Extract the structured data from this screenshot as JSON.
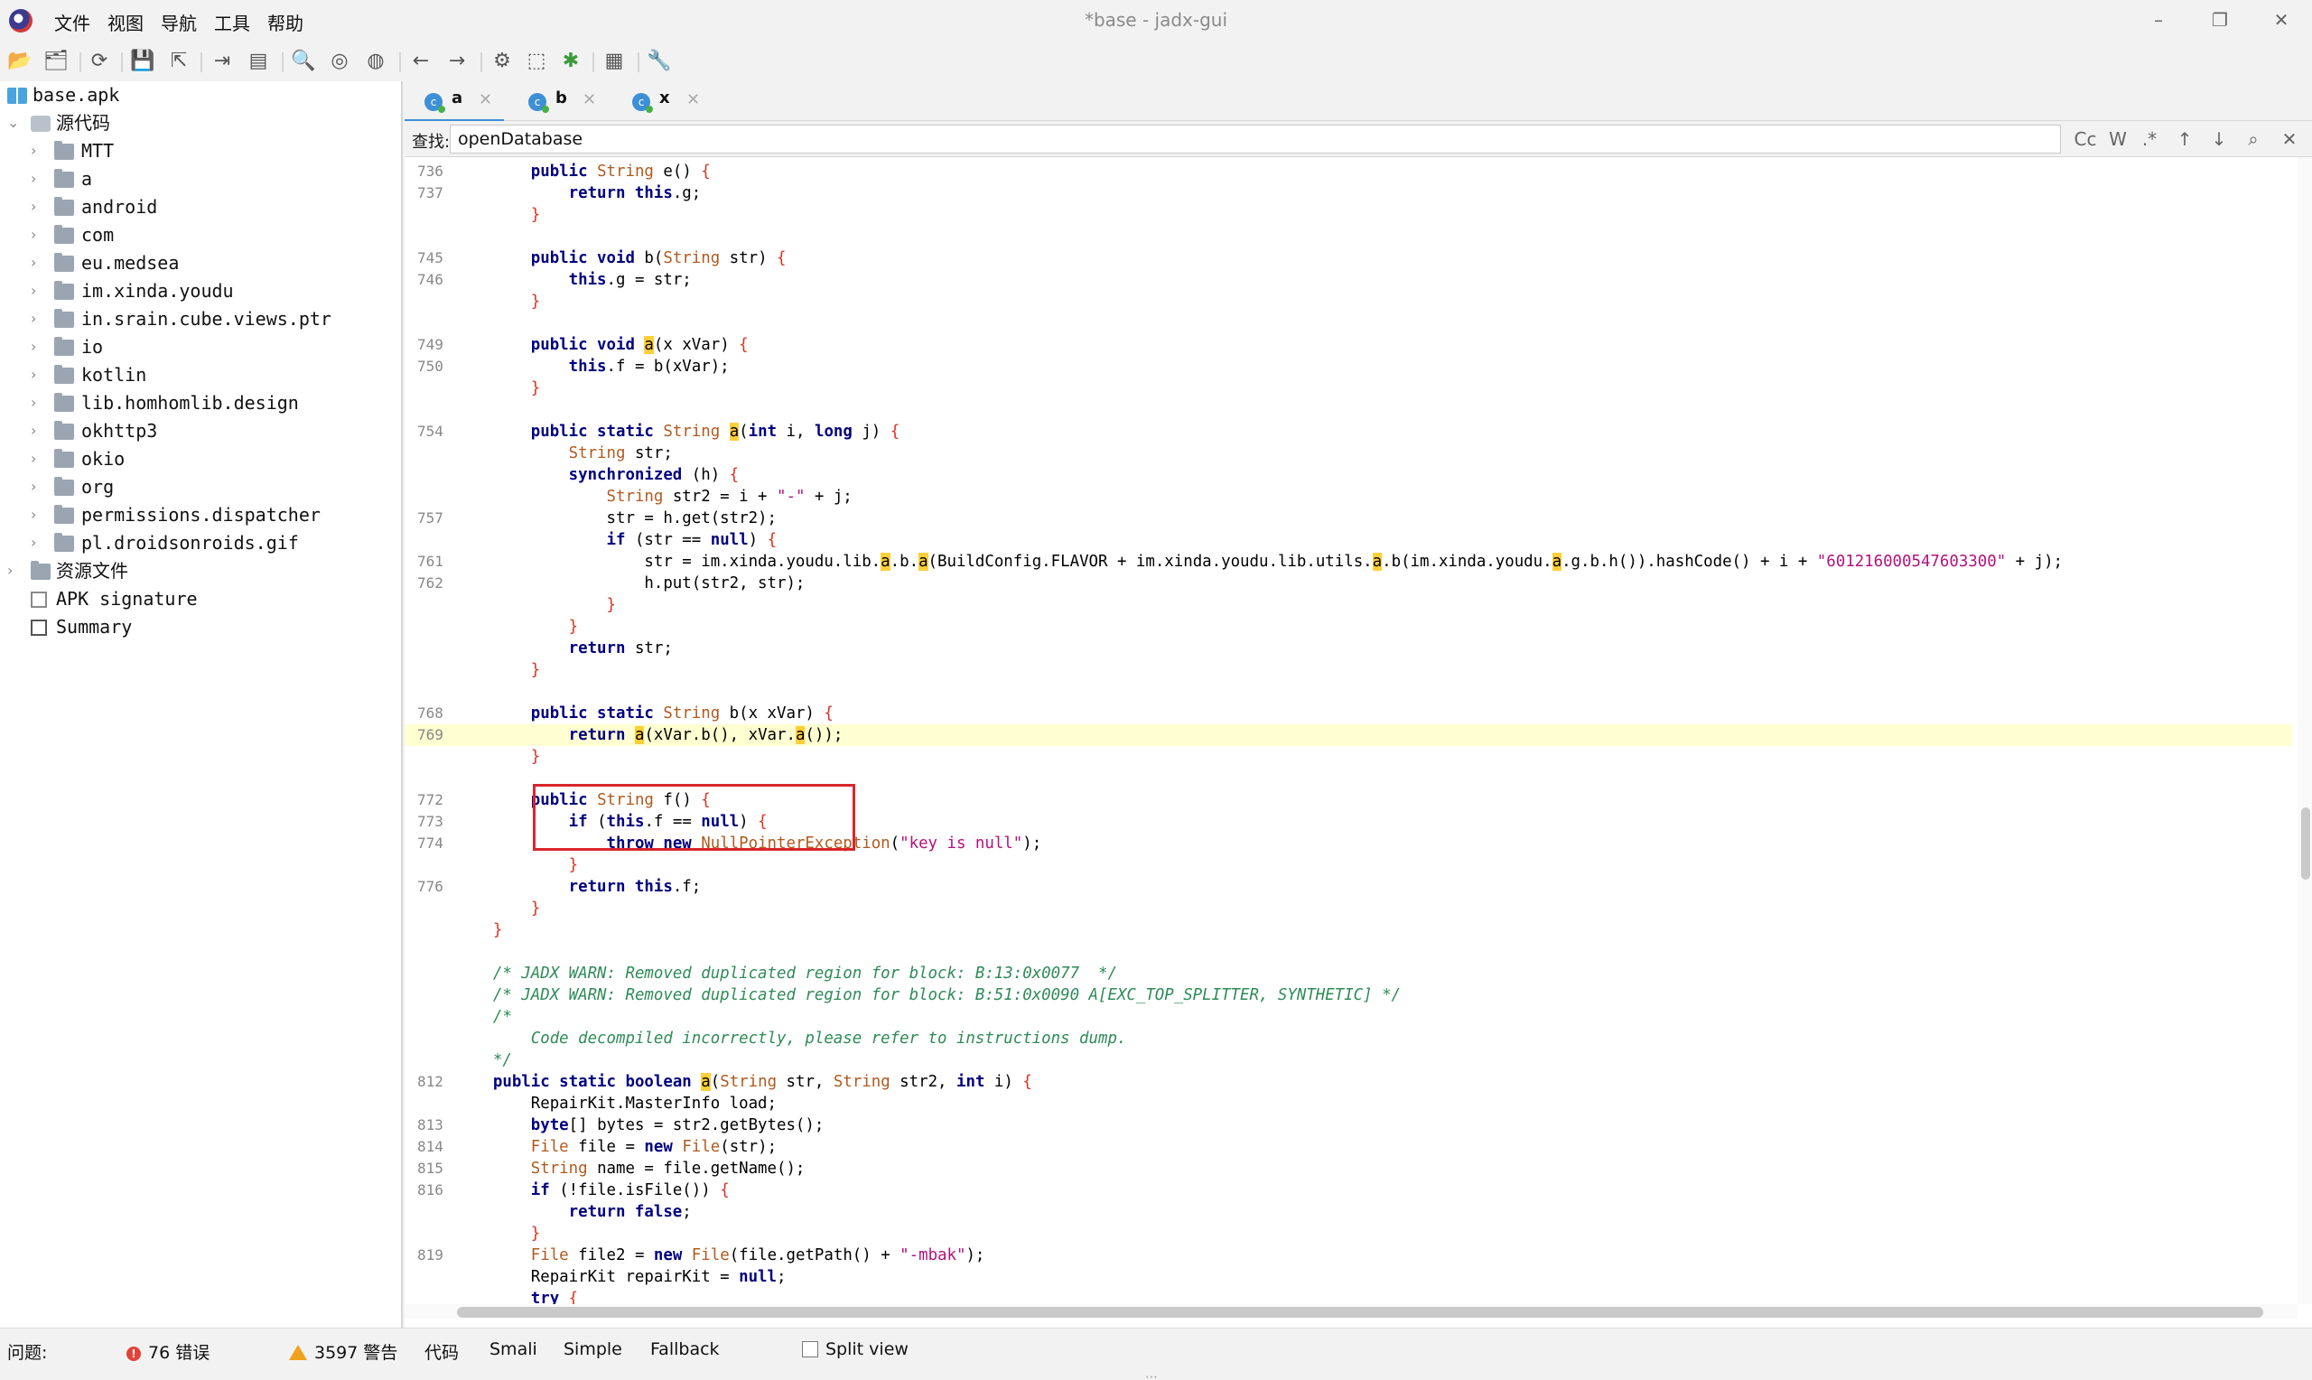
{
  "window": {
    "title": "*base - jadx-gui",
    "minimize": "–",
    "restore": "❐",
    "close": "✕"
  },
  "menu": [
    "文件",
    "视图",
    "导航",
    "工具",
    "帮助"
  ],
  "toolbar": [
    "open-icon",
    "add-files-icon",
    "refresh-icon",
    "save-icon",
    "export-icon",
    "sync-icon",
    "flatten-icon",
    "search-icon",
    "find-usage-icon",
    "find-class-icon",
    "back-icon",
    "forward-icon",
    "deobfuscation-icon",
    "quick-tabs-icon",
    "debug-icon",
    "log-icon",
    "preferences-icon"
  ],
  "tree": [
    {
      "label": "base.apk",
      "type": "apk",
      "depth": 0
    },
    {
      "label": "源代码",
      "type": "source",
      "depth": 0,
      "expanded": true
    },
    {
      "label": "MTT",
      "type": "package",
      "depth": 1
    },
    {
      "label": "a",
      "type": "package",
      "depth": 1
    },
    {
      "label": "android",
      "type": "package",
      "depth": 1
    },
    {
      "label": "com",
      "type": "package",
      "depth": 1
    },
    {
      "label": "eu.medsea",
      "type": "package",
      "depth": 1
    },
    {
      "label": "im.xinda.youdu",
      "type": "package",
      "depth": 1
    },
    {
      "label": "in.srain.cube.views.ptr",
      "type": "package",
      "depth": 1
    },
    {
      "label": "io",
      "type": "package",
      "depth": 1
    },
    {
      "label": "kotlin",
      "type": "package",
      "depth": 1
    },
    {
      "label": "lib.homhomlib.design",
      "type": "package",
      "depth": 1
    },
    {
      "label": "okhttp3",
      "type": "package",
      "depth": 1
    },
    {
      "label": "okio",
      "type": "package",
      "depth": 1
    },
    {
      "label": "org",
      "type": "package",
      "depth": 1
    },
    {
      "label": "permissions.dispatcher",
      "type": "package",
      "depth": 1
    },
    {
      "label": "pl.droidsonroids.gif",
      "type": "package",
      "depth": 1
    },
    {
      "label": "资源文件",
      "type": "resources",
      "depth": 0
    },
    {
      "label": "APK signature",
      "type": "signature",
      "depth": 0
    },
    {
      "label": "Summary",
      "type": "summary",
      "depth": 0
    }
  ],
  "tabs": [
    {
      "label": "a",
      "active": true
    },
    {
      "label": "b",
      "active": false
    },
    {
      "label": "x",
      "active": false
    }
  ],
  "find": {
    "label": "查找:",
    "value": "openDatabase",
    "options": [
      "Cc",
      "W",
      ".*"
    ]
  },
  "status": {
    "problems_label": "问题:",
    "errors": "76 错误",
    "warnings": "3597 警告",
    "views": [
      "代码",
      "Smali",
      "Simple",
      "Fallback"
    ],
    "split_view": "Split view",
    "grip": "⋯"
  }
}
